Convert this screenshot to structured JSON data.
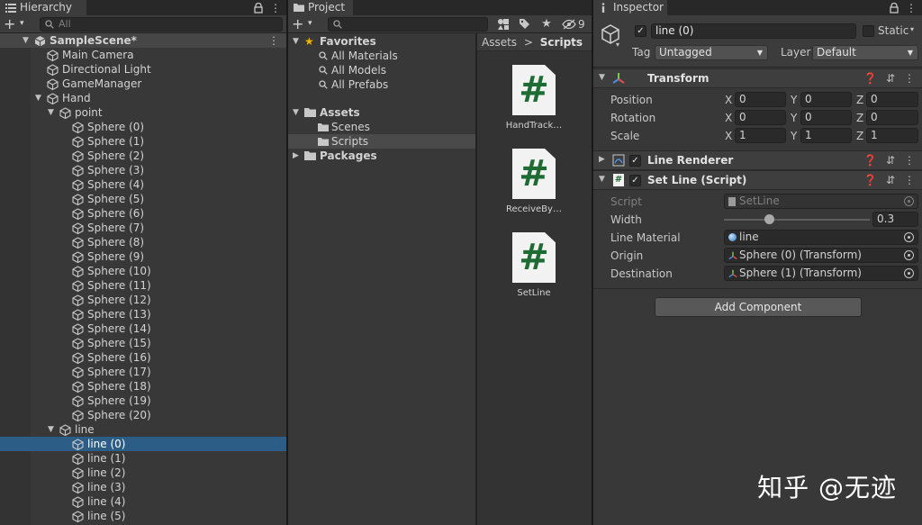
{
  "hierarchy": {
    "tab_label": "Hierarchy",
    "search_placeholder": "All",
    "rows": [
      {
        "label": "SampleScene*",
        "depth": 0,
        "arrow": "down",
        "kind": "scene"
      },
      {
        "label": "Main Camera",
        "depth": 1,
        "arrow": "",
        "kind": "obj"
      },
      {
        "label": "Directional Light",
        "depth": 1,
        "arrow": "",
        "kind": "obj"
      },
      {
        "label": "GameManager",
        "depth": 1,
        "arrow": "",
        "kind": "obj"
      },
      {
        "label": "Hand",
        "depth": 1,
        "arrow": "down",
        "kind": "obj"
      },
      {
        "label": "point",
        "depth": 2,
        "arrow": "down",
        "kind": "obj"
      },
      {
        "label": "Sphere (0)",
        "depth": 3,
        "arrow": "",
        "kind": "obj"
      },
      {
        "label": "Sphere (1)",
        "depth": 3,
        "arrow": "",
        "kind": "obj"
      },
      {
        "label": "Sphere (2)",
        "depth": 3,
        "arrow": "",
        "kind": "obj"
      },
      {
        "label": "Sphere (3)",
        "depth": 3,
        "arrow": "",
        "kind": "obj"
      },
      {
        "label": "Sphere (4)",
        "depth": 3,
        "arrow": "",
        "kind": "obj"
      },
      {
        "label": "Sphere (5)",
        "depth": 3,
        "arrow": "",
        "kind": "obj"
      },
      {
        "label": "Sphere (6)",
        "depth": 3,
        "arrow": "",
        "kind": "obj"
      },
      {
        "label": "Sphere (7)",
        "depth": 3,
        "arrow": "",
        "kind": "obj"
      },
      {
        "label": "Sphere (8)",
        "depth": 3,
        "arrow": "",
        "kind": "obj"
      },
      {
        "label": "Sphere (9)",
        "depth": 3,
        "arrow": "",
        "kind": "obj"
      },
      {
        "label": "Sphere (10)",
        "depth": 3,
        "arrow": "",
        "kind": "obj"
      },
      {
        "label": "Sphere (11)",
        "depth": 3,
        "arrow": "",
        "kind": "obj"
      },
      {
        "label": "Sphere (12)",
        "depth": 3,
        "arrow": "",
        "kind": "obj"
      },
      {
        "label": "Sphere (13)",
        "depth": 3,
        "arrow": "",
        "kind": "obj"
      },
      {
        "label": "Sphere (14)",
        "depth": 3,
        "arrow": "",
        "kind": "obj"
      },
      {
        "label": "Sphere (15)",
        "depth": 3,
        "arrow": "",
        "kind": "obj"
      },
      {
        "label": "Sphere (16)",
        "depth": 3,
        "arrow": "",
        "kind": "obj"
      },
      {
        "label": "Sphere (17)",
        "depth": 3,
        "arrow": "",
        "kind": "obj"
      },
      {
        "label": "Sphere (18)",
        "depth": 3,
        "arrow": "",
        "kind": "obj"
      },
      {
        "label": "Sphere (19)",
        "depth": 3,
        "arrow": "",
        "kind": "obj"
      },
      {
        "label": "Sphere (20)",
        "depth": 3,
        "arrow": "",
        "kind": "obj"
      },
      {
        "label": "line",
        "depth": 2,
        "arrow": "down",
        "kind": "obj"
      },
      {
        "label": "line (0)",
        "depth": 3,
        "arrow": "",
        "kind": "obj",
        "selected": true
      },
      {
        "label": "line (1)",
        "depth": 3,
        "arrow": "",
        "kind": "obj"
      },
      {
        "label": "line (2)",
        "depth": 3,
        "arrow": "",
        "kind": "obj"
      },
      {
        "label": "line (3)",
        "depth": 3,
        "arrow": "",
        "kind": "obj"
      },
      {
        "label": "line (4)",
        "depth": 3,
        "arrow": "",
        "kind": "obj"
      },
      {
        "label": "line (5)",
        "depth": 3,
        "arrow": "",
        "kind": "obj"
      }
    ]
  },
  "project": {
    "tab_label": "Project",
    "hidden_count": "9",
    "favorites_label": "Favorites",
    "favorites": [
      "All Materials",
      "All Models",
      "All Prefabs"
    ],
    "assets_label": "Assets",
    "asset_folders": [
      "Scenes",
      "Scripts"
    ],
    "packages_label": "Packages",
    "breadcrumb": {
      "root": "Assets",
      "separator": ">",
      "current": "Scripts"
    },
    "files": [
      "HandTrack…",
      "ReceiveBy…",
      "SetLine"
    ],
    "file_glyph": "#"
  },
  "inspector": {
    "tab_label": "Inspector",
    "object_name": "line (0)",
    "static_label": "Static",
    "tag_label": "Tag",
    "tag_value": "Untagged",
    "layer_label": "Layer",
    "layer_value": "Default",
    "transform": {
      "title": "Transform",
      "rows": [
        {
          "label": "Position",
          "x": "0",
          "y": "0",
          "z": "0"
        },
        {
          "label": "Rotation",
          "x": "0",
          "y": "0",
          "z": "0"
        },
        {
          "label": "Scale",
          "x": "1",
          "y": "1",
          "z": "1"
        }
      ],
      "axis_x": "X",
      "axis_y": "Y",
      "axis_z": "Z"
    },
    "line_renderer": {
      "title": "Line Renderer"
    },
    "set_line": {
      "title": "Set Line (Script)",
      "script_label": "Script",
      "script_value": "SetLine",
      "width_label": "Width",
      "width_value": "0.3",
      "width_fraction": 0.3,
      "material_label": "Line Material",
      "material_value": "line",
      "origin_label": "Origin",
      "origin_value": "Sphere (0) (Transform)",
      "destination_label": "Destination",
      "destination_value": "Sphere (1) (Transform)"
    },
    "add_component_label": "Add Component"
  },
  "watermark": "知乎 @无迹",
  "colors": {
    "selection": "#2c5d87",
    "panel": "#383838",
    "script_hash": "#1e6b33"
  }
}
